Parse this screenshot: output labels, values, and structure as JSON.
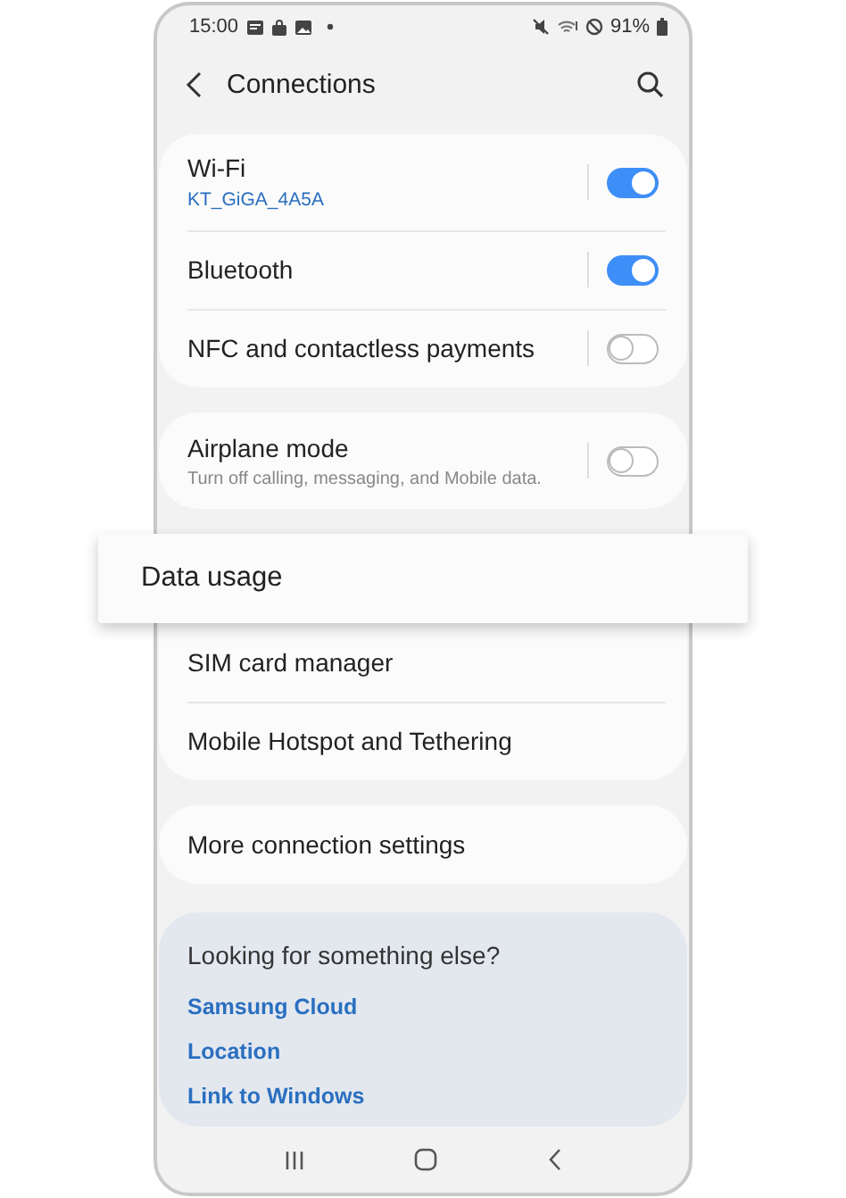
{
  "status_bar": {
    "time": "15:00",
    "battery": "91%"
  },
  "header": {
    "title": "Connections"
  },
  "groups": [
    {
      "items": [
        {
          "kind": "toggle",
          "title": "Wi-Fi",
          "subtitle": "KT_GiGA_4A5A",
          "subtitle_accent": true,
          "on": true
        },
        {
          "kind": "toggle",
          "title": "Bluetooth",
          "on": true
        },
        {
          "kind": "toggle",
          "title": "NFC and contactless payments",
          "on": false
        }
      ]
    },
    {
      "items": [
        {
          "kind": "toggle",
          "title": "Airplane mode",
          "subtitle": "Turn off calling, messaging, and Mobile data.",
          "subtitle_accent": false,
          "on": false
        }
      ]
    },
    {
      "items": [
        {
          "kind": "raised",
          "title": "Data usage"
        },
        {
          "kind": "plain",
          "title": "SIM card manager"
        },
        {
          "kind": "plain",
          "title": "Mobile Hotspot and Tethering"
        }
      ]
    },
    {
      "items": [
        {
          "kind": "plain",
          "title": "More connection settings"
        }
      ]
    }
  ],
  "suggestions": {
    "title": "Looking for something else?",
    "links": [
      "Samsung Cloud",
      "Location",
      "Link to Windows"
    ]
  }
}
